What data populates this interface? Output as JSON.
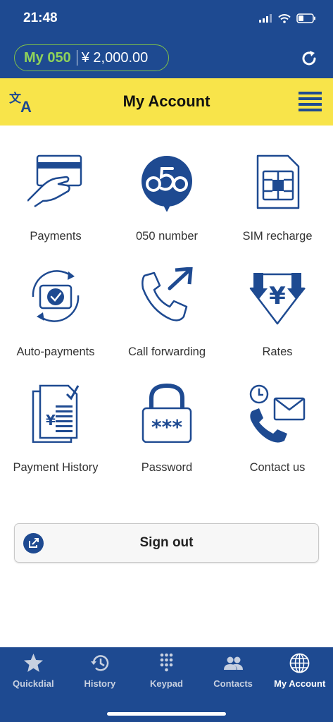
{
  "status": {
    "time": "21:48"
  },
  "balance": {
    "label": "My 050",
    "amount": "¥ 2,000.00"
  },
  "header": {
    "title": "My Account"
  },
  "tiles": [
    {
      "label": "Payments",
      "icon": "credit-card-hand-icon"
    },
    {
      "label": "050 number",
      "icon": "050-number-icon"
    },
    {
      "label": "SIM recharge",
      "icon": "sim-card-icon"
    },
    {
      "label": "Auto-payments",
      "icon": "auto-payment-icon"
    },
    {
      "label": "Call forwarding",
      "icon": "call-forward-icon"
    },
    {
      "label": "Rates",
      "icon": "yen-down-arrow-icon"
    },
    {
      "label": "Payment History",
      "icon": "invoice-icon"
    },
    {
      "label": "Password",
      "icon": "padlock-icon"
    },
    {
      "label": "Contact us",
      "icon": "phone-mail-icon"
    }
  ],
  "signout": {
    "label": "Sign out"
  },
  "tabs": [
    {
      "label": "Quickdial",
      "icon": "star-icon",
      "active": false
    },
    {
      "label": "History",
      "icon": "history-icon",
      "active": false
    },
    {
      "label": "Keypad",
      "icon": "keypad-icon",
      "active": false
    },
    {
      "label": "Contacts",
      "icon": "contacts-icon",
      "active": false
    },
    {
      "label": "My Account",
      "icon": "globe-icon",
      "active": true
    }
  ],
  "colors": {
    "primary": "#1e4a91",
    "header": "#f8e44a",
    "accent_green": "#8fd25a"
  }
}
